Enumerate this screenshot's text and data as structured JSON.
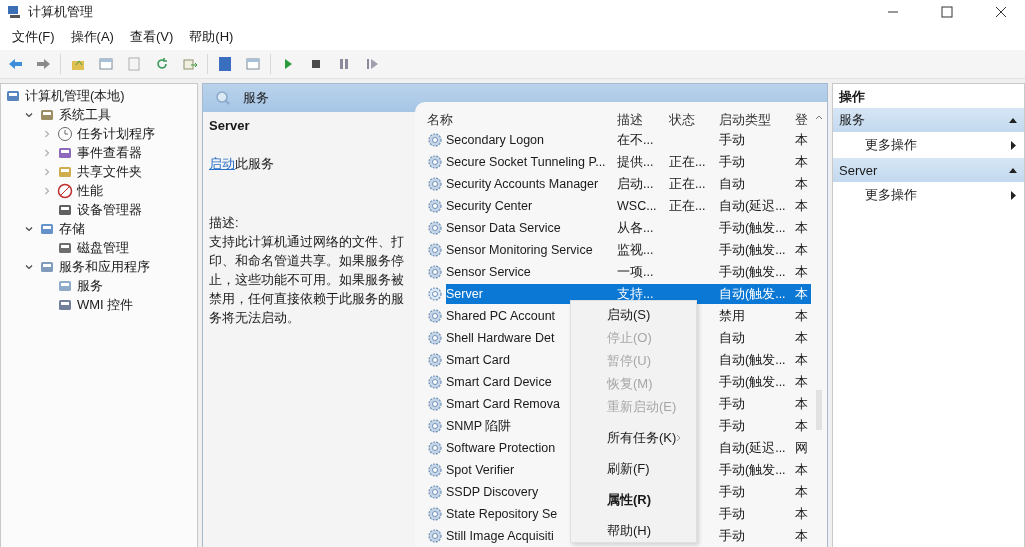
{
  "window": {
    "title": "计算机管理"
  },
  "menu": [
    "文件(F)",
    "操作(A)",
    "查看(V)",
    "帮助(H)"
  ],
  "tree": [
    {
      "label": "计算机管理(本地)",
      "children": [
        {
          "label": "系统工具",
          "expanded": true,
          "children": [
            {
              "label": "任务计划程序",
              "expanded": false
            },
            {
              "label": "事件查看器",
              "expanded": false
            },
            {
              "label": "共享文件夹",
              "expanded": false
            },
            {
              "label": "性能",
              "expanded": false
            },
            {
              "label": "设备管理器"
            }
          ]
        },
        {
          "label": "存储",
          "expanded": true,
          "children": [
            {
              "label": "磁盘管理"
            }
          ]
        },
        {
          "label": "服务和应用程序",
          "expanded": true,
          "children": [
            {
              "label": "服务"
            },
            {
              "label": "WMI 控件"
            }
          ]
        }
      ]
    }
  ],
  "center": {
    "title": "服务",
    "detail": {
      "name": "Server",
      "action_link": "启动",
      "action_text": "此服务",
      "description_label": "描述:",
      "description": "支持此计算机通过网络的文件、打印、和命名管道共享。如果服务停止，这些功能不可用。如果服务被禁用，任何直接依赖于此服务的服务将无法启动。"
    },
    "table": {
      "columns": [
        "名称",
        "描述",
        "状态",
        "启动类型",
        "登"
      ],
      "rows": [
        {
          "name": "Secondary Logon",
          "description": "在不...",
          "startup": "手动",
          "logon": "本",
          "selected": false
        },
        {
          "name": "Secure Socket Tunneling P...",
          "description": "提供...",
          "status": "正在...",
          "startup": "手动",
          "logon": "本",
          "selected": false
        },
        {
          "name": "Security Accounts Manager",
          "description": "启动...",
          "status": "正在...",
          "startup": "自动",
          "logon": "本",
          "selected": false
        },
        {
          "name": "Security Center",
          "description": "WSC...",
          "status": "正在...",
          "startup": "自动(延迟...",
          "logon": "本",
          "selected": false
        },
        {
          "name": "Sensor Data Service",
          "description": "从各...",
          "startup": "手动(触发...",
          "logon": "本",
          "selected": false
        },
        {
          "name": "Sensor Monitoring Service",
          "description": "监视...",
          "startup": "手动(触发...",
          "logon": "本",
          "selected": false
        },
        {
          "name": "Sensor Service",
          "description": "一项...",
          "startup": "手动(触发...",
          "logon": "本",
          "selected": false
        },
        {
          "name": "Server",
          "description": "支持...",
          "startup": "自动(触发...",
          "logon": "本",
          "selected": true
        },
        {
          "name": "Shared PC Account",
          "startup": "禁用",
          "logon": "本",
          "selected": false
        },
        {
          "name": "Shell Hardware Det",
          "startup": "自动",
          "logon": "本",
          "selected": false
        },
        {
          "name": "Smart Card",
          "startup": "自动(触发...",
          "logon": "本",
          "selected": false
        },
        {
          "name": "Smart Card Device",
          "startup": "手动(触发...",
          "logon": "本",
          "selected": false
        },
        {
          "name": "Smart Card Remova",
          "startup": "手动",
          "logon": "本",
          "selected": false
        },
        {
          "name": "SNMP 陷阱",
          "startup": "手动",
          "logon": "本",
          "selected": false
        },
        {
          "name": "Software Protection",
          "startup": "自动(延迟...",
          "logon": "网",
          "selected": false
        },
        {
          "name": "Spot Verifier",
          "startup": "手动(触发...",
          "logon": "本",
          "selected": false
        },
        {
          "name": "SSDP Discovery",
          "startup": "手动",
          "logon": "本",
          "selected": false
        },
        {
          "name": "State Repository Se",
          "startup": "手动",
          "logon": "本",
          "selected": false
        },
        {
          "name": "Still Image Acquisiti",
          "startup": "手动",
          "logon": "本",
          "selected": false
        }
      ]
    },
    "context_menu": [
      {
        "kind": "item",
        "label": "启动(S)",
        "disabled": false
      },
      {
        "kind": "item",
        "label": "停止(O)",
        "disabled": true
      },
      {
        "kind": "item",
        "label": "暂停(U)",
        "disabled": true
      },
      {
        "kind": "item",
        "label": "恢复(M)",
        "disabled": true
      },
      {
        "kind": "item",
        "label": "重新启动(E)",
        "disabled": true
      },
      {
        "kind": "separator"
      },
      {
        "kind": "item",
        "label": "所有任务(K)",
        "disabled": false,
        "submenu": true
      },
      {
        "kind": "separator"
      },
      {
        "kind": "item",
        "label": "刷新(F)",
        "disabled": false
      },
      {
        "kind": "separator"
      },
      {
        "kind": "item",
        "label": "属性(R)",
        "disabled": false,
        "default": true
      },
      {
        "kind": "separator"
      },
      {
        "kind": "item",
        "label": "帮助(H)",
        "disabled": false
      }
    ]
  },
  "actions": {
    "title": "操作",
    "sections": [
      {
        "title": "服务",
        "expanded": true,
        "items": [
          "更多操作"
        ]
      },
      {
        "title": "Server",
        "expanded": true,
        "items": [
          "更多操作"
        ]
      }
    ]
  }
}
